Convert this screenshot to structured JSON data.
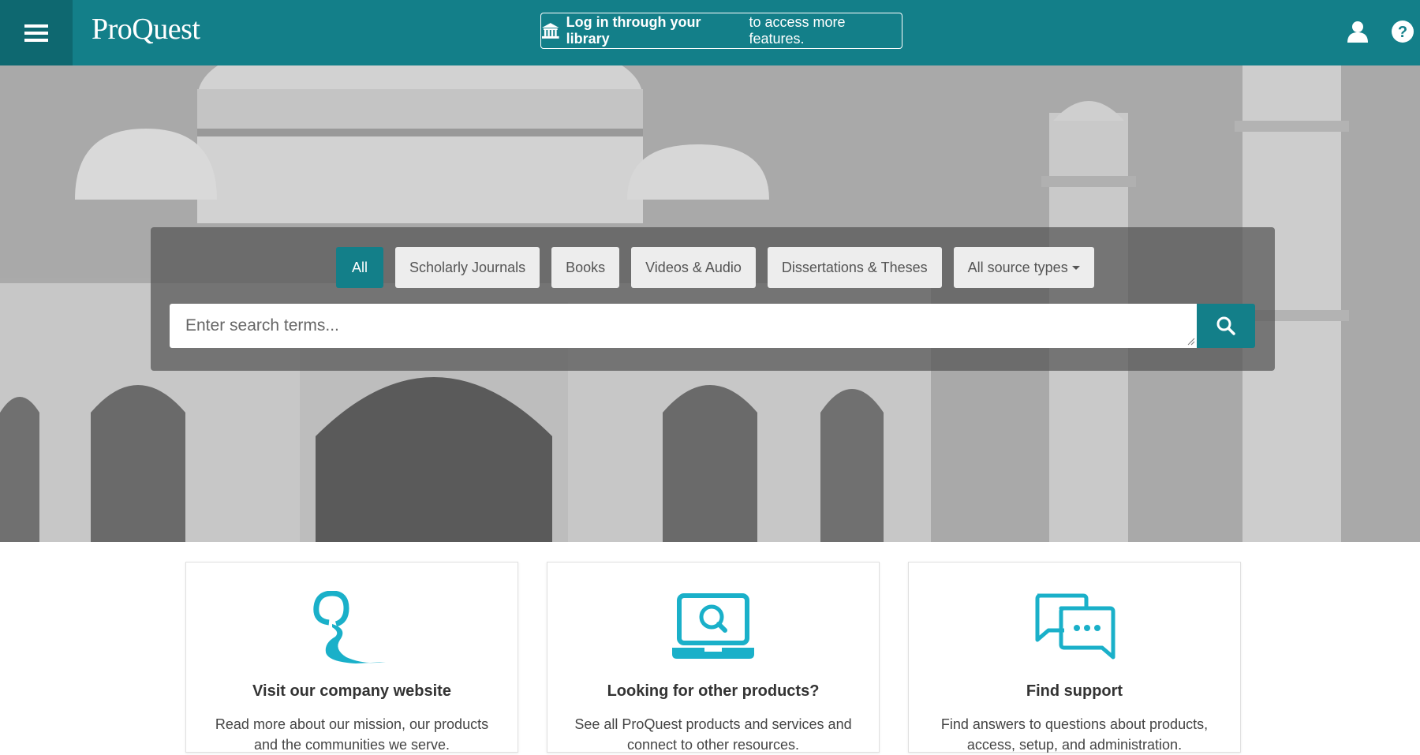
{
  "header": {
    "logo": "ProQuest",
    "login_bold": "Log in through your library",
    "login_rest": "to access more features."
  },
  "search": {
    "tabs": [
      "All",
      "Scholarly Journals",
      "Books",
      "Videos & Audio",
      "Dissertations & Theses"
    ],
    "source_types_label": "All source types",
    "placeholder": "Enter search terms..."
  },
  "cards": [
    {
      "title": "Visit our company website",
      "desc": "Read more about our mission, our products and the communities we serve."
    },
    {
      "title": "Looking for other products?",
      "desc": "See all ProQuest products and services and connect to other resources."
    },
    {
      "title": "Find support",
      "desc": "Find answers to questions about products, access, setup, and administration."
    }
  ],
  "colors": {
    "brand": "#137f89",
    "brand_dark": "#0e6870",
    "accent_icon": "#1ab0c9"
  },
  "icons": [
    "menu-icon",
    "library-icon",
    "user-icon",
    "help-icon",
    "search-icon",
    "proquest-q-icon",
    "laptop-search-icon",
    "chat-bubbles-icon"
  ]
}
